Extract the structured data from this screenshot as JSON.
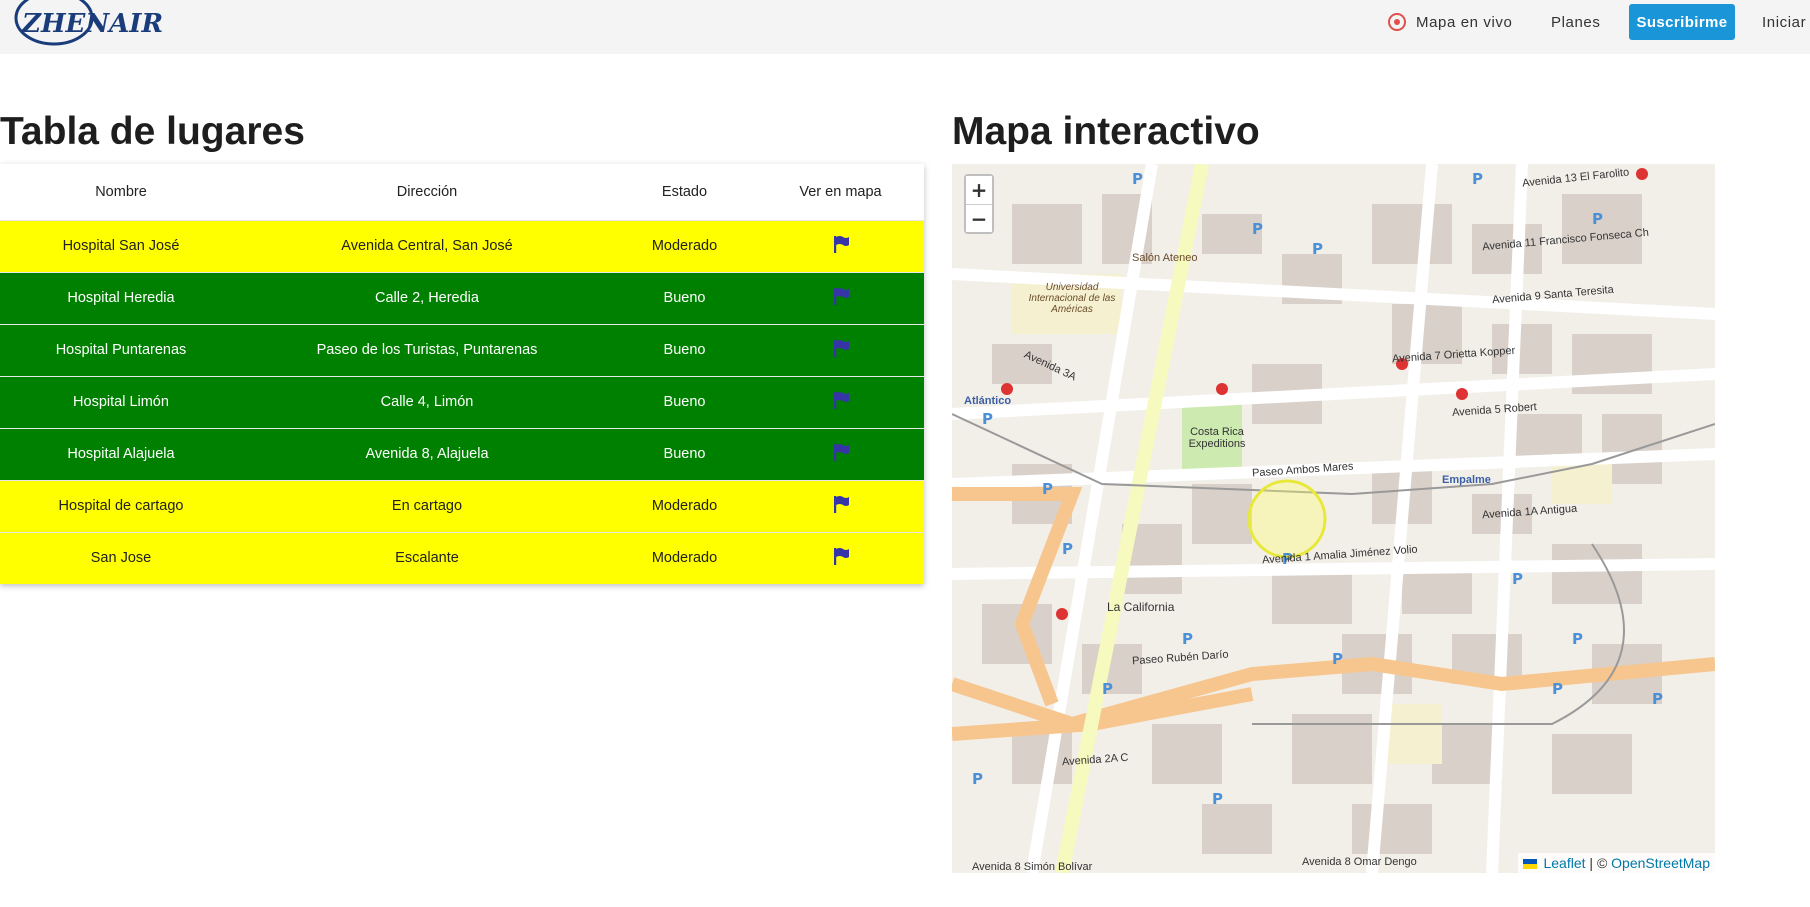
{
  "header": {
    "logo_text": "ZHENAIR",
    "nav_live_map": "Mapa en vivo",
    "nav_plans": "Planes",
    "subscribe_button": "Suscribirme",
    "nav_login": "Iniciar"
  },
  "places": {
    "title": "Tabla de lugares",
    "columns": [
      "Nombre",
      "Dirección",
      "Estado",
      "Ver en mapa"
    ],
    "rows": [
      {
        "name": "Hospital San José",
        "address": "Avenida Central, San José",
        "state": "Moderado"
      },
      {
        "name": "Hospital Heredia",
        "address": "Calle 2, Heredia",
        "state": "Bueno"
      },
      {
        "name": "Hospital Puntarenas",
        "address": "Paseo de los Turistas, Puntarenas",
        "state": "Bueno"
      },
      {
        "name": "Hospital Limón",
        "address": "Calle 4, Limón",
        "state": "Bueno"
      },
      {
        "name": "Hospital Alajuela",
        "address": "Avenida 8, Alajuela",
        "state": "Bueno"
      },
      {
        "name": "Hospital de cartago",
        "address": "En cartago",
        "state": "Moderado"
      },
      {
        "name": "San Jose",
        "address": "Escalante",
        "state": "Moderado"
      }
    ]
  },
  "map": {
    "title": "Mapa interactivo",
    "zoom_in": "+",
    "zoom_out": "−",
    "attribution_leaflet": "Leaflet",
    "attribution_sep": " | © ",
    "attribution_osm": "OpenStreetMap",
    "labels": [
      "Avenida 13 El Farolito",
      "Avenida 11 Francisco Fonseca Ch",
      "Avenida 9 Santa Teresita",
      "Avenida 7 Orietta Kopper",
      "Avenida 5 Robert",
      "Paseo Ambos Mares",
      "Avenida 1A Antigua",
      "Avenida 1 Amalia Jiménez Volio",
      "Paseo Rubén Darío",
      "Avenida 2A C",
      "Avenida 8 Omar Dengo",
      "Avenida 8 Simón Bolívar",
      "Avenida 3A",
      "Empalme",
      "La California",
      "Universidad Internacional de las Américas",
      "Salón Ateneo",
      "Costa Rica Expeditions",
      "Atlántico"
    ]
  },
  "colors": {
    "moderate": "#ffff00",
    "good": "#008000",
    "flag": "#3535a8",
    "accent": "#1995d8"
  }
}
